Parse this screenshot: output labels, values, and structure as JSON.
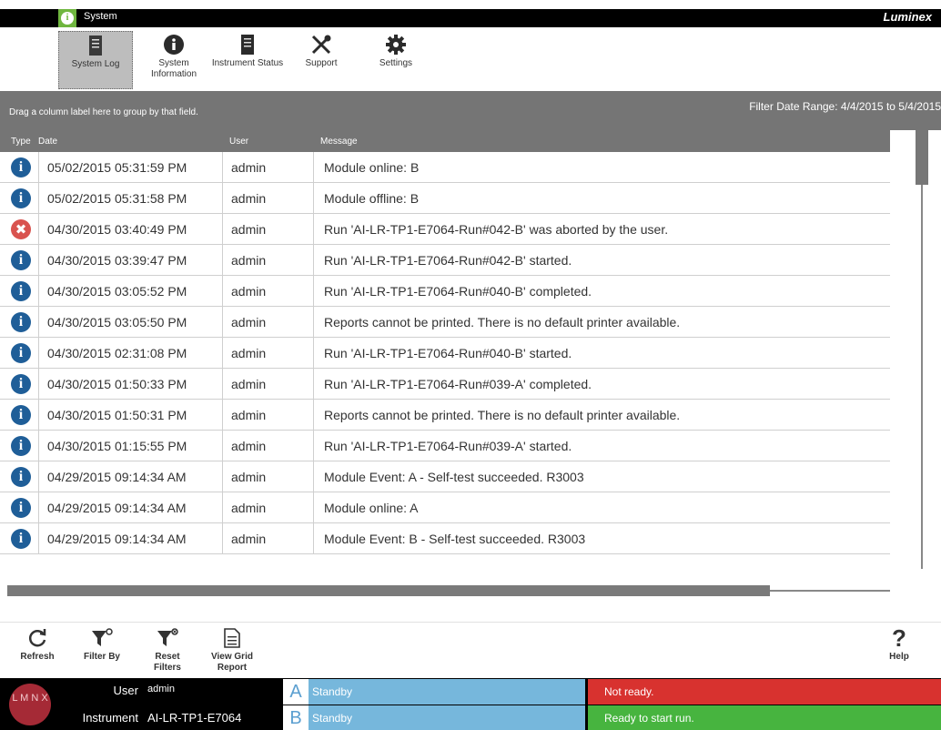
{
  "app": {
    "section_title": "System",
    "brand": "Luminex"
  },
  "toolbar": {
    "items": [
      {
        "label": "System Log",
        "icon": "document-icon",
        "active": true
      },
      {
        "label": "System Information",
        "icon": "info-icon",
        "active": false
      },
      {
        "label": "Instrument Status",
        "icon": "instrument-icon",
        "active": false
      },
      {
        "label": "Support",
        "icon": "tools-icon",
        "active": false
      },
      {
        "label": "Settings",
        "icon": "gear-icon",
        "active": false
      }
    ]
  },
  "grid": {
    "group_hint": "Drag a column label here to group by that field.",
    "filter_range": "Filter Date Range: 4/4/2015 to 5/4/2015",
    "columns": [
      "Type",
      "Date",
      "User",
      "Message"
    ],
    "rows": [
      {
        "type": "info",
        "date": "05/02/2015 05:31:59 PM",
        "user": "admin",
        "message": "Module online: B"
      },
      {
        "type": "info",
        "date": "05/02/2015 05:31:58 PM",
        "user": "admin",
        "message": "Module offline: B"
      },
      {
        "type": "error",
        "date": "04/30/2015 03:40:49 PM",
        "user": "admin",
        "message": "Run 'AI-LR-TP1-E7064-Run#042-B' was aborted by the user."
      },
      {
        "type": "info",
        "date": "04/30/2015 03:39:47 PM",
        "user": "admin",
        "message": "Run 'AI-LR-TP1-E7064-Run#042-B' started."
      },
      {
        "type": "info",
        "date": "04/30/2015 03:05:52 PM",
        "user": "admin",
        "message": "Run 'AI-LR-TP1-E7064-Run#040-B' completed."
      },
      {
        "type": "info",
        "date": "04/30/2015 03:05:50 PM",
        "user": "admin",
        "message": "Reports cannot be printed. There is no default printer available."
      },
      {
        "type": "info",
        "date": "04/30/2015 02:31:08 PM",
        "user": "admin",
        "message": "Run 'AI-LR-TP1-E7064-Run#040-B' started."
      },
      {
        "type": "info",
        "date": "04/30/2015 01:50:33 PM",
        "user": "admin",
        "message": "Run 'AI-LR-TP1-E7064-Run#039-A' completed."
      },
      {
        "type": "info",
        "date": "04/30/2015 01:50:31 PM",
        "user": "admin",
        "message": "Reports cannot be printed. There is no default printer available."
      },
      {
        "type": "info",
        "date": "04/30/2015 01:15:55 PM",
        "user": "admin",
        "message": "Run 'AI-LR-TP1-E7064-Run#039-A' started."
      },
      {
        "type": "info",
        "date": "04/29/2015 09:14:34 AM",
        "user": "admin",
        "message": "Module Event: A - Self-test succeeded.  R3003"
      },
      {
        "type": "info",
        "date": "04/29/2015 09:14:34 AM",
        "user": "admin",
        "message": "Module online: A"
      },
      {
        "type": "info",
        "date": "04/29/2015 09:14:34 AM",
        "user": "admin",
        "message": "Module Event: B - Self-test succeeded.  R3003"
      }
    ]
  },
  "actions": {
    "refresh": "Refresh",
    "filter_by": "Filter By",
    "reset_filters": "Reset Filters",
    "view_grid_report": "View Grid Report",
    "help": "Help"
  },
  "status": {
    "logo_text": "L M N X",
    "user_label": "User",
    "user_value": "admin",
    "instrument_label": "Instrument",
    "instrument_value": "AI-LR-TP1-E7064",
    "module_a": {
      "slot": "A",
      "state": "Standby"
    },
    "module_b": {
      "slot": "B",
      "state": "Standby"
    },
    "ready_a": {
      "text": "Not ready.",
      "color": "#d8322f"
    },
    "ready_b": {
      "text": "Ready to start run.",
      "color": "#47b43f"
    }
  }
}
